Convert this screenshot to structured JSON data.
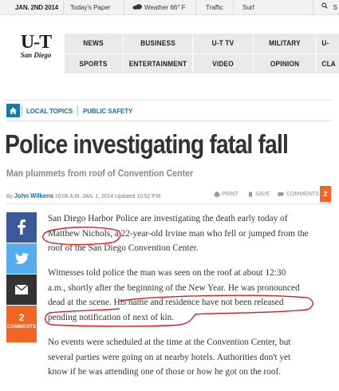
{
  "topbar": {
    "date": "JAN. 2ND 2014",
    "todays_paper": "Today's Paper",
    "weather": "Weather 66° F",
    "traffic": "Traffic",
    "surf": "Surf",
    "search": "S"
  },
  "logo": {
    "mark": "U-T",
    "city": "San Diego"
  },
  "nav": {
    "row1": [
      "NEWS",
      "BUSINESS",
      "U-T TV",
      "MILITARY",
      "U-"
    ],
    "row2": [
      "SPORTS",
      "ENTERTAINMENT",
      "VIDEO",
      "OPINION",
      "CLA"
    ]
  },
  "breadcrumb": {
    "items": [
      "LOCAL TOPICS",
      "PUBLIC SAFETY"
    ]
  },
  "article": {
    "title": "Police investigating fatal fall",
    "subtitle": "Man plummets from roof of Convention Center",
    "byline": {
      "by": "By",
      "author": "John Wilkens",
      "time": "10:06 A.M.",
      "date": "JAN. 1, 2014",
      "updated": "Updated 10:52 P.M."
    },
    "tools": {
      "print": "PRINT",
      "save": "SAVE",
      "comments": "COMMENTS"
    },
    "comment_count": "2",
    "paragraphs": [
      [
        "San Diego Harbor Police are investigating the death early today of",
        "Matthew Nichols, a 22-year-old Irvine man who fell or jumped from the",
        "roof of the San Diego Convention Center."
      ],
      [
        "Witnesses told police the man was seen on the roof at about 12:30",
        "a.m., shortly after the beginning of the New Year. He was pronounced",
        "dead at the scene. His name and residence have not been released",
        "pending notification of next of kin."
      ],
      [
        "No events were scheduled at the time at the Convention Center, but",
        "several parties were going on at nearby hotels. Authorities don't yet",
        "know if he was attending one of those or how he got on the roof."
      ]
    ]
  },
  "share": {
    "comment_count": "2",
    "comments_label": "COMMENTS"
  },
  "colors": {
    "accent": "#1a7ba4",
    "comments": "#f26522",
    "facebook": "#3b5998",
    "twitter": "#55acee",
    "annotation": "#d42020"
  },
  "icons": [
    "cloud-icon",
    "search-icon",
    "home-icon",
    "print-icon",
    "bookmark-icon",
    "comment-icon",
    "facebook-icon",
    "twitter-icon",
    "email-icon"
  ]
}
